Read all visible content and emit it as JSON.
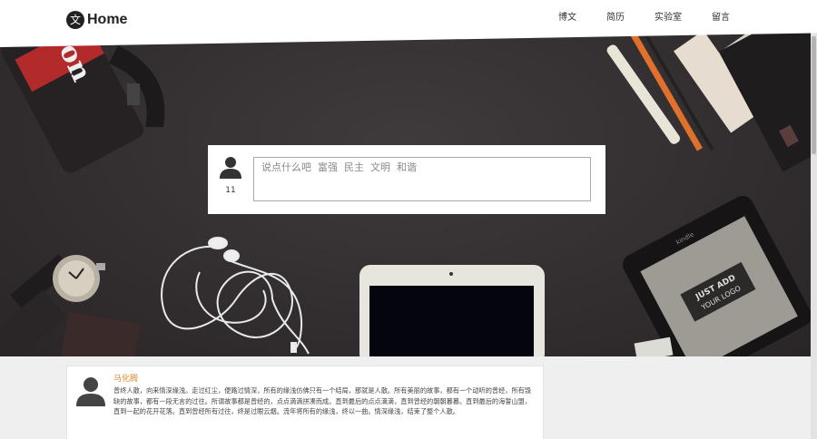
{
  "header": {
    "logo_badge": "文",
    "logo_text": "Home",
    "nav": [
      "博文",
      "简历",
      "实验室",
      "留言"
    ]
  },
  "hero": {
    "icons": [
      "camera-icon",
      "pens-icon",
      "notebook-icon",
      "earphones-icon",
      "watch-icon",
      "tablet-icon",
      "kindle-icon",
      "book-icon"
    ],
    "logo_card_lines": [
      "JUST ADD",
      "YOUR LOGO"
    ],
    "kindle_label": "kindle",
    "camera_text": "on"
  },
  "comment_box": {
    "count": "11",
    "placeholder": "说点什么吧  富强  民主  文明  和谐"
  },
  "post": {
    "author": "马化腾",
    "text": "曾终人散，向来情深缘浅。走过红尘，便路过情深，所有的缘浅仿佛只有一个结局，那就是人散。所有美丽的故事，都有一个动听的曾经，所有毁缺的故事，都有一段无言的过往。所谓故事都是曾经的，点点滴滴拼凑而成。直到最后的点点滴滴，直到曾经的朝朝暮暮。直到最后的海誓山盟，直到一起的花开花落。直到曾经所有过往，终是过眼云烟。流年将所有的缘浅，终以一曲。情深缘浅，结束了整个人散。"
  },
  "colors": {
    "accent": "#e08a2c",
    "header_bg": "#ffffff",
    "desk": "#363234"
  }
}
